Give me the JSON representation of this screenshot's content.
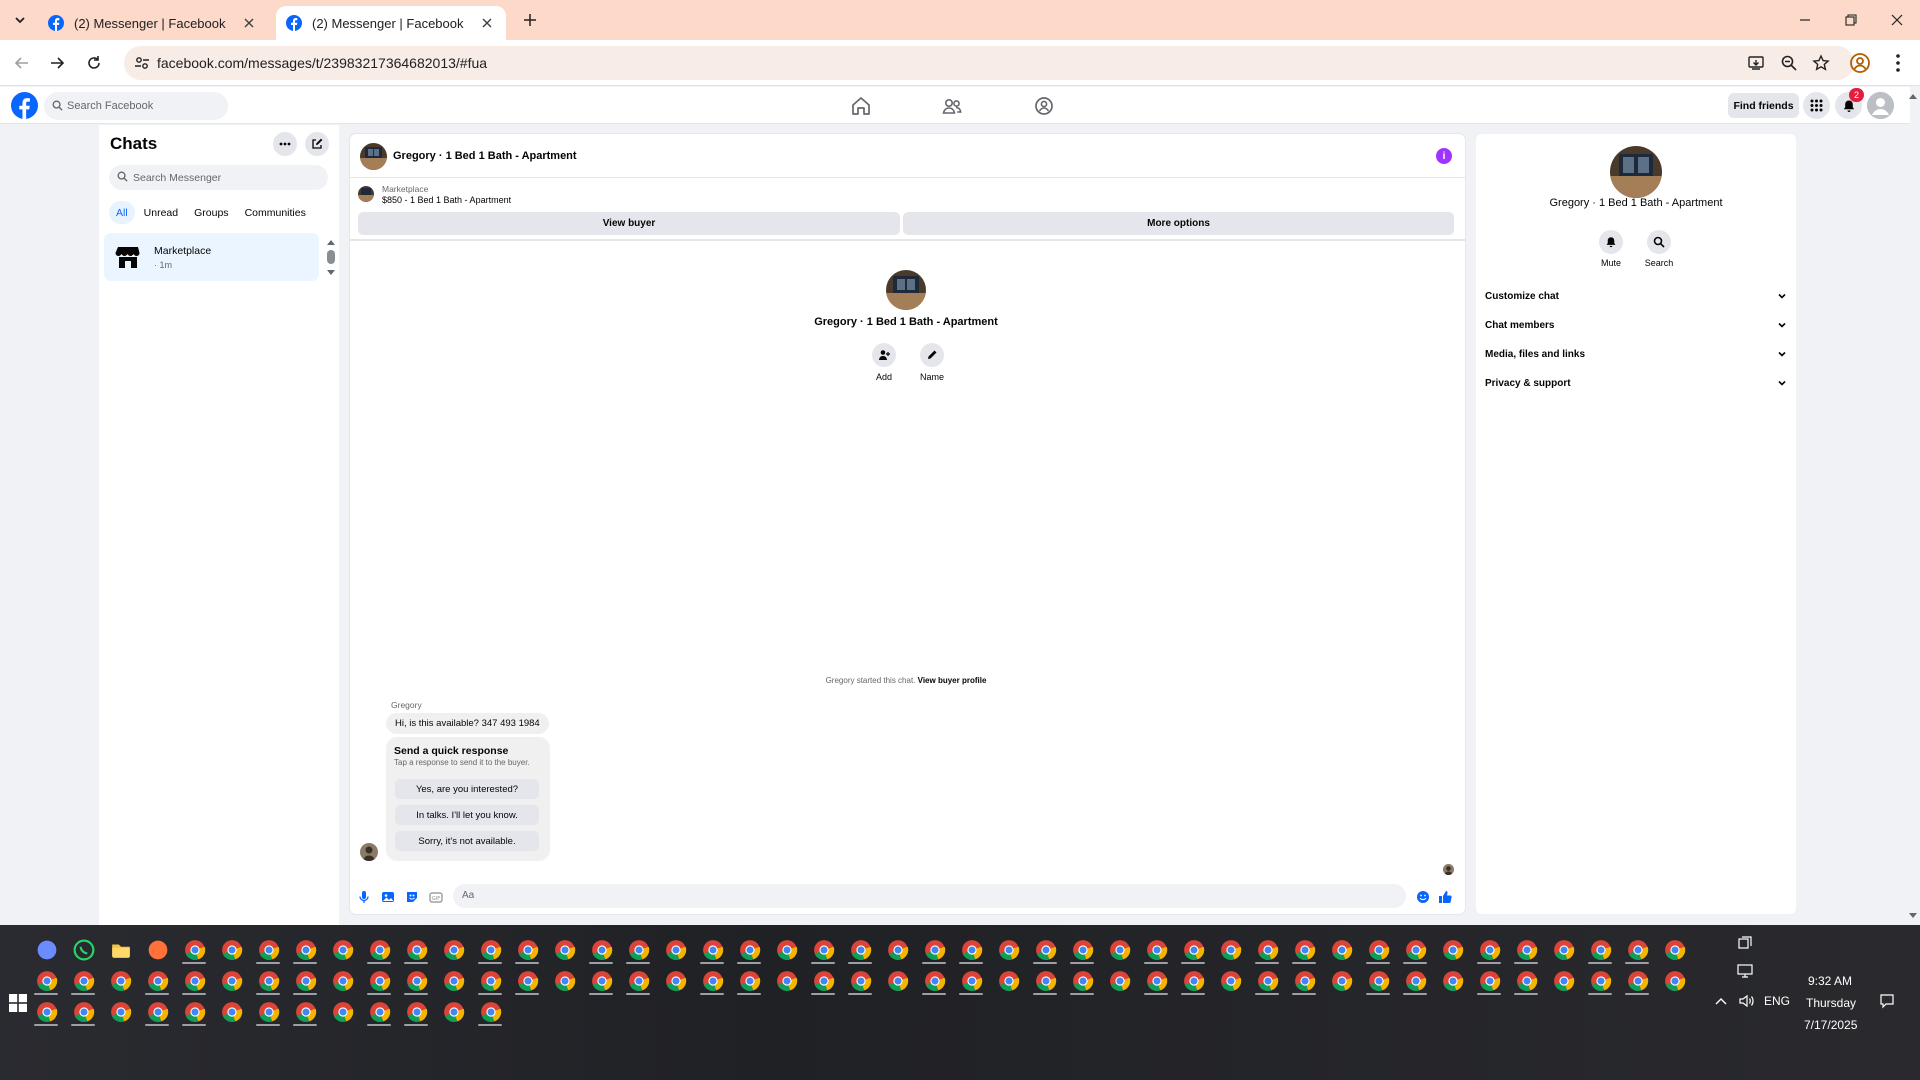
{
  "browser": {
    "tabs": [
      {
        "title": "(2) Messenger | Facebook",
        "active": false
      },
      {
        "title": "(2) Messenger | Facebook",
        "active": true
      }
    ],
    "url": "facebook.com/messages/t/23983217364682013/#fua",
    "tab_bar_color": "#fcd9c8"
  },
  "fb": {
    "search_placeholder": "Search Facebook",
    "find_friends": "Find friends",
    "notification_count": "2",
    "nav_icons": [
      "home-icon",
      "friends-icon",
      "groups-icon"
    ],
    "brand_color": "#0866ff"
  },
  "chats": {
    "title": "Chats",
    "search_placeholder": "Search Messenger",
    "filters": [
      "All",
      "Unread",
      "Groups",
      "Communities"
    ],
    "active_filter": "All",
    "items": [
      {
        "name": "Marketplace",
        "time": "· 1m",
        "icon": "store-icon"
      }
    ]
  },
  "conversation": {
    "title": "Gregory · 1 Bed 1 Bath - Apartment",
    "marketplace_label": "Marketplace",
    "listing": "$850 - 1 Bed 1 Bath - Apartment",
    "view_buyer": "View buyer",
    "more_options": "More options",
    "center_name": "Gregory · 1 Bed 1 Bath - Apartment",
    "actions": [
      {
        "label": "Add",
        "icon": "add-person-icon"
      },
      {
        "label": "Name",
        "icon": "pencil-icon"
      }
    ],
    "started_text": "Gregory started this chat.",
    "view_buyer_profile": "View buyer profile",
    "sender": "Gregory",
    "message": "Hi, is this available? 347 493 1984",
    "quick_response": {
      "title": "Send a quick response",
      "subtitle": "Tap a response to send it to the buyer.",
      "options": [
        "Yes, are you interested?",
        "In talks. I'll let you know.",
        "Sorry, it's not available."
      ]
    },
    "composer_placeholder": "Aa"
  },
  "info_panel": {
    "name": "Gregory · 1 Bed 1 Bath - Apartment",
    "actions": [
      {
        "label": "Mute",
        "icon": "bell-icon"
      },
      {
        "label": "Search",
        "icon": "search-icon"
      }
    ],
    "sections": [
      "Customize chat",
      "Chat members",
      "Media, files and links",
      "Privacy & support"
    ]
  },
  "taskbar": {
    "time": "9:32 AM",
    "day": "Thursday",
    "date": "7/17/2025",
    "language": "ENG"
  }
}
